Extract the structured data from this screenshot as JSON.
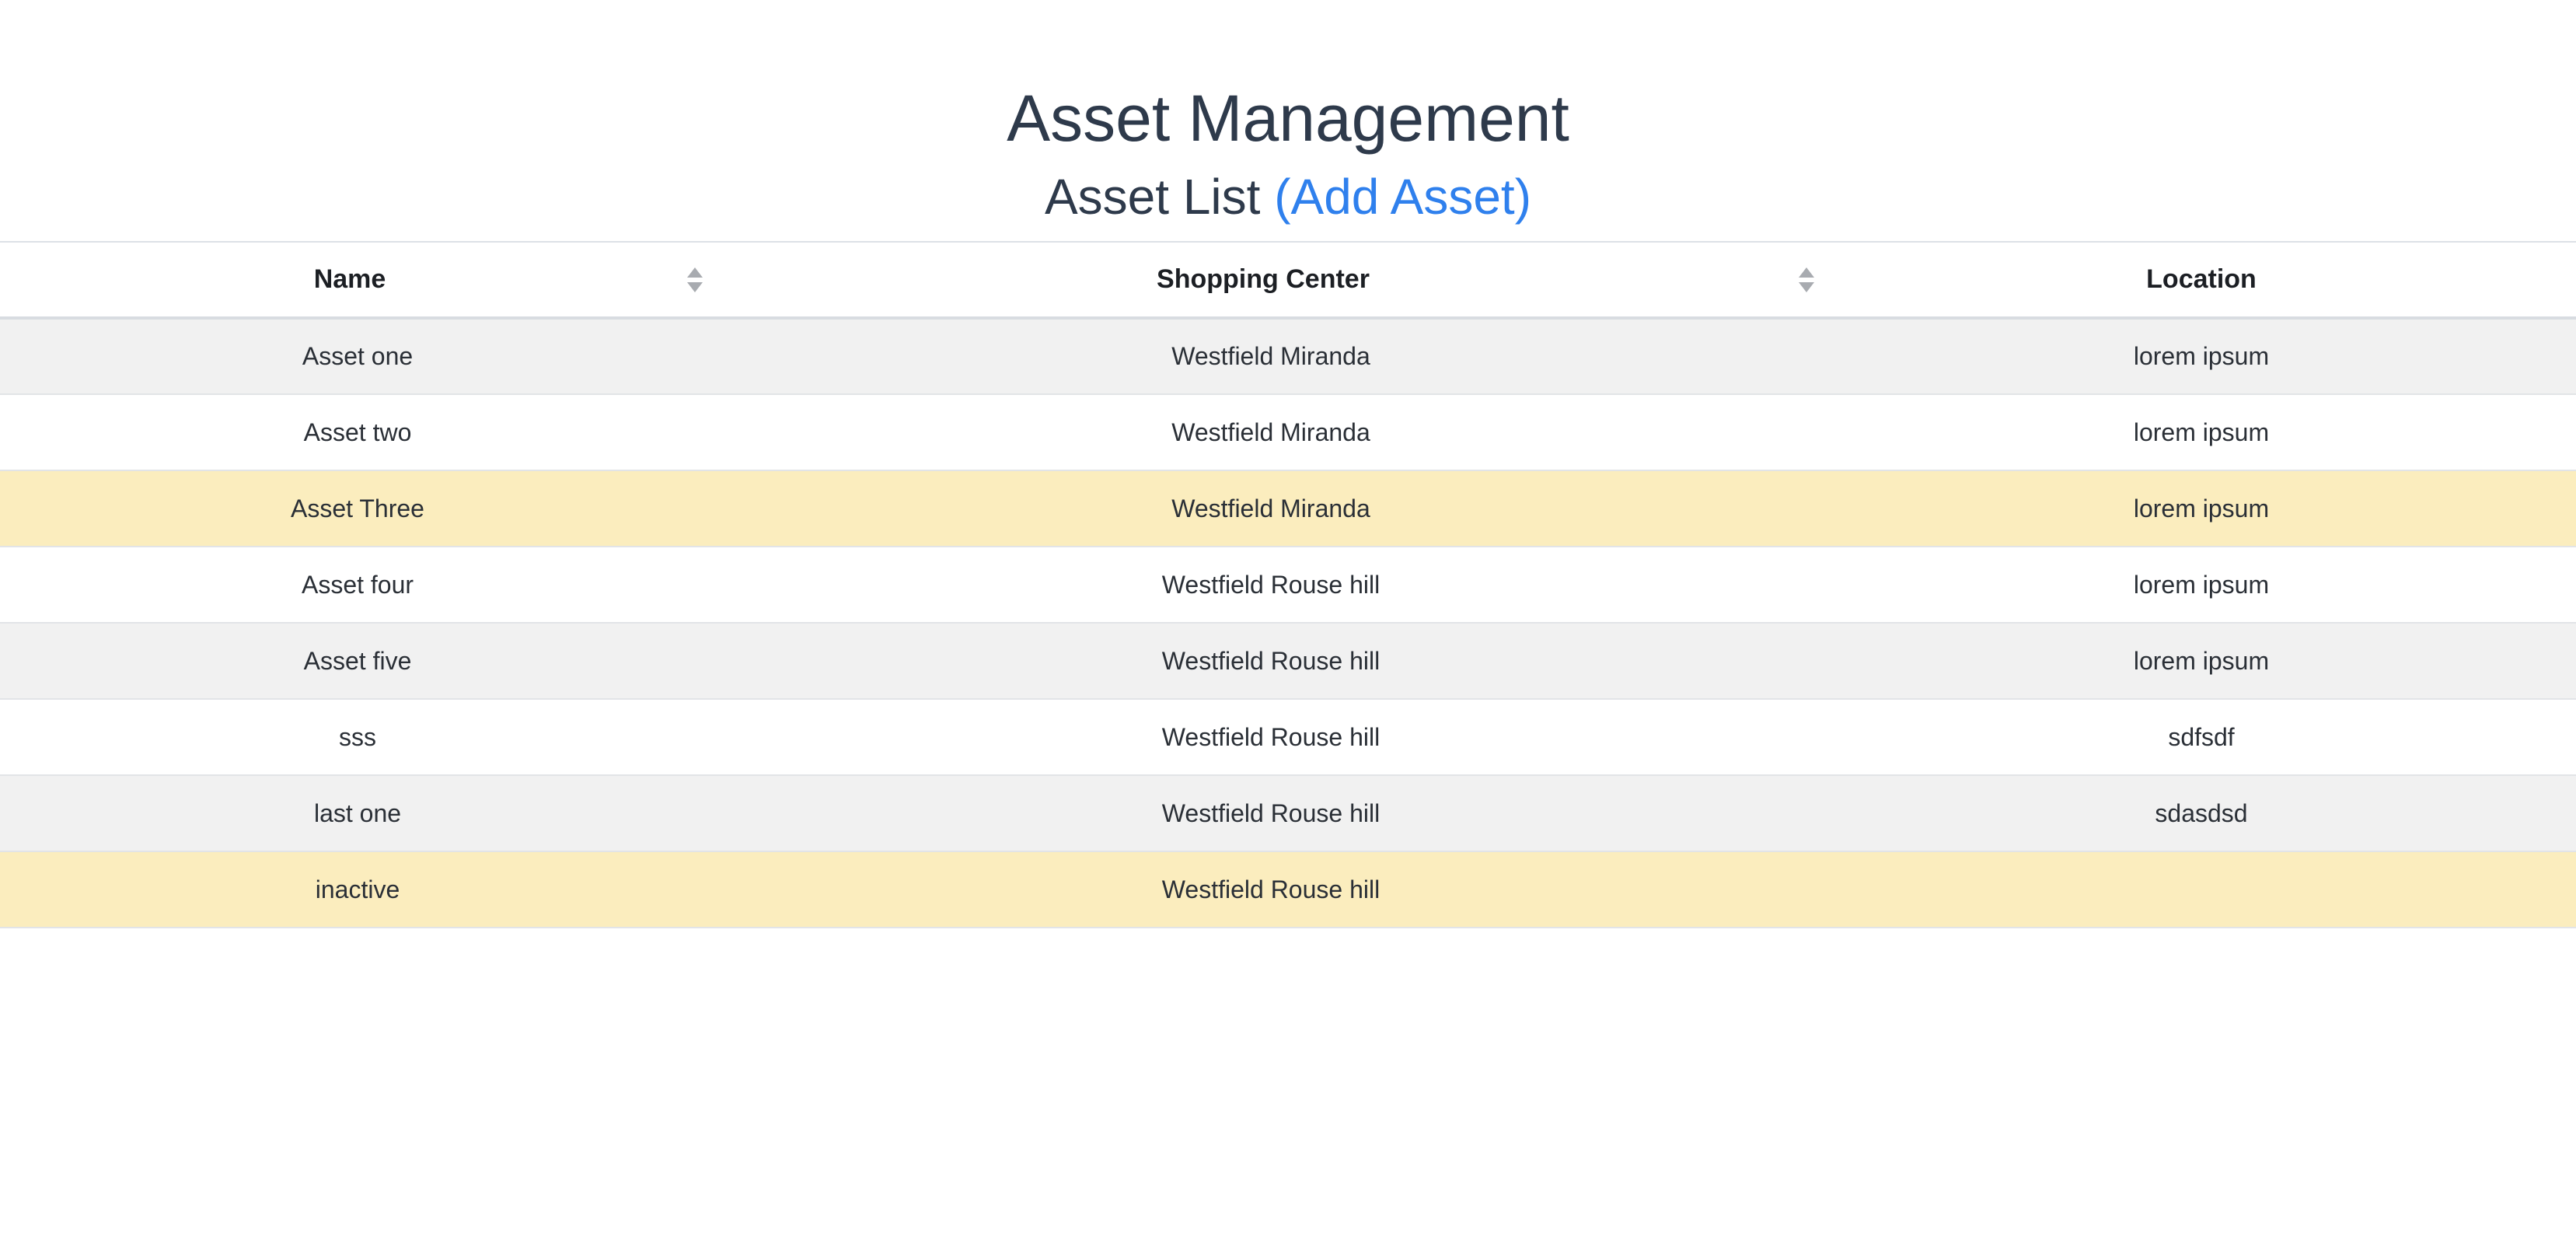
{
  "header": {
    "title": "Asset Management",
    "subtitle": "Asset List",
    "add_link": "(Add Asset)"
  },
  "colors": {
    "accent_link": "#2f80ed",
    "row_highlight": "#fbedbe",
    "row_striped": "#f1f1f1"
  },
  "table": {
    "columns": [
      {
        "label": "Name",
        "sortable": true
      },
      {
        "label": "Shopping Center",
        "sortable": true
      },
      {
        "label": "Location",
        "sortable": false
      }
    ],
    "rows": [
      {
        "name": "Asset one",
        "center": "Westfield Miranda",
        "location": "lorem ipsum",
        "style": "gray"
      },
      {
        "name": "Asset two",
        "center": "Westfield Miranda",
        "location": "lorem ipsum",
        "style": "white"
      },
      {
        "name": "Asset Three",
        "center": "Westfield Miranda",
        "location": "lorem ipsum",
        "style": "highlight"
      },
      {
        "name": "Asset four",
        "center": "Westfield Rouse hill",
        "location": "lorem ipsum",
        "style": "white"
      },
      {
        "name": "Asset five",
        "center": "Westfield Rouse hill",
        "location": "lorem ipsum",
        "style": "gray"
      },
      {
        "name": "sss",
        "center": "Westfield Rouse hill",
        "location": "sdfsdf",
        "style": "white"
      },
      {
        "name": "last one",
        "center": "Westfield Rouse hill",
        "location": "sdasdsd",
        "style": "gray"
      },
      {
        "name": "inactive",
        "center": "Westfield Rouse hill",
        "location": "",
        "style": "highlight"
      }
    ]
  }
}
